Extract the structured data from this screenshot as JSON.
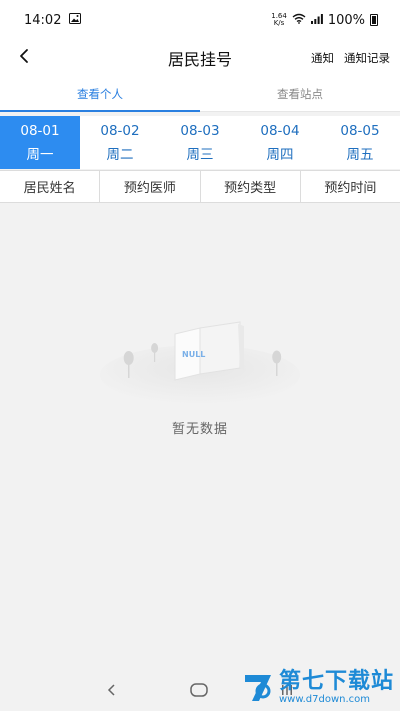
{
  "status_bar": {
    "time": "14:02",
    "net_speed_value": "1.64",
    "net_speed_unit": "K/s",
    "battery": "100%"
  },
  "header": {
    "title": "居民挂号",
    "action_notify": "通知",
    "action_notify_history": "通知记录"
  },
  "tabs": [
    {
      "label": "查看个人",
      "active": true
    },
    {
      "label": "查看站点",
      "active": false
    }
  ],
  "dates": [
    {
      "date": "08-01",
      "weekday": "周一",
      "active": true
    },
    {
      "date": "08-02",
      "weekday": "周二",
      "active": false
    },
    {
      "date": "08-03",
      "weekday": "周三",
      "active": false
    },
    {
      "date": "08-04",
      "weekday": "周四",
      "active": false
    },
    {
      "date": "08-05",
      "weekday": "周五",
      "active": false
    }
  ],
  "columns": [
    "居民姓名",
    "预约医师",
    "预约类型",
    "预约时间"
  ],
  "empty_state": {
    "illustration_label": "NULL",
    "text": "暂无数据"
  },
  "watermark": {
    "main": "第七下载站",
    "sub": "www.d7down.com"
  },
  "colors": {
    "accent": "#2d8cf0",
    "date_text": "#1f6fbf",
    "watermark": "#1e8ad6"
  }
}
